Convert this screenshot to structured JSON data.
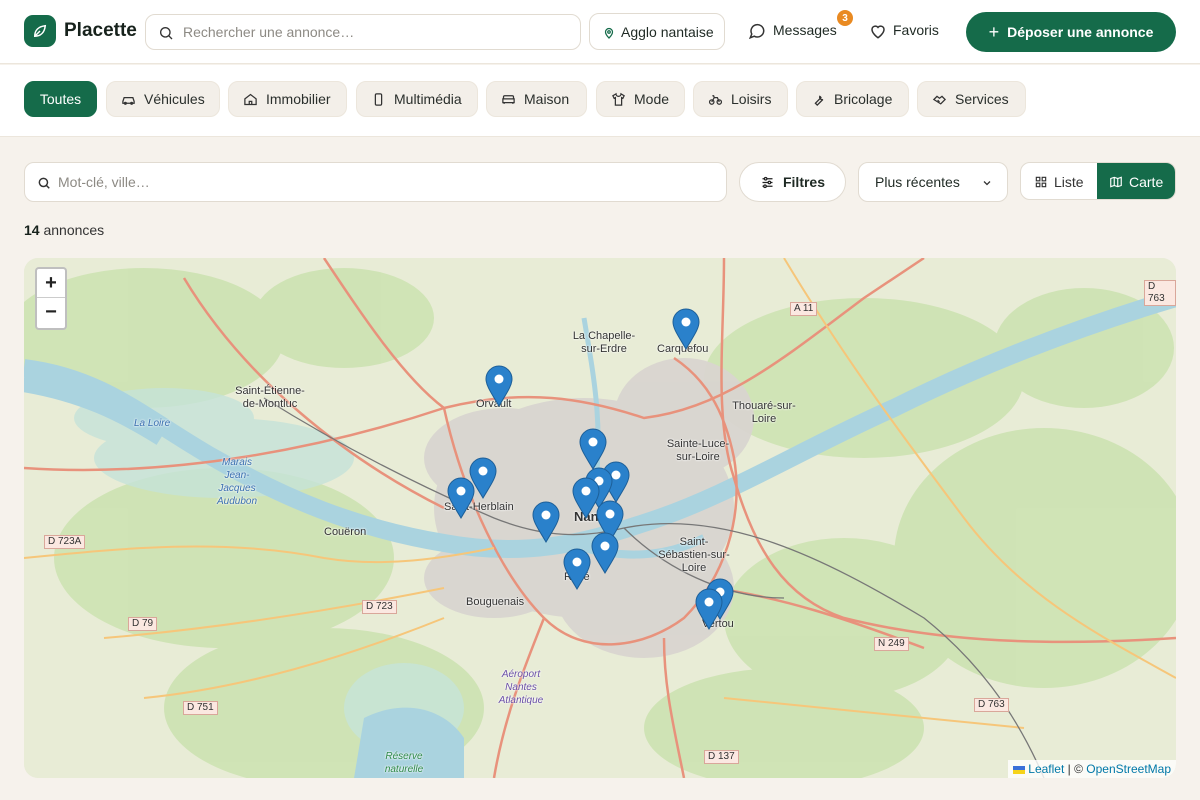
{
  "header": {
    "brand": "Placette",
    "search_placeholder": "Rechercher une annonce…",
    "location": "Agglo nantaise",
    "messages_label": "Messages",
    "messages_count": "3",
    "favorites_label": "Favoris",
    "post_label": "Déposer une annonce"
  },
  "categories": [
    {
      "label": "Toutes",
      "icon": "none",
      "active": true
    },
    {
      "label": "Véhicules",
      "icon": "car-icon"
    },
    {
      "label": "Immobilier",
      "icon": "home-icon"
    },
    {
      "label": "Multimédia",
      "icon": "phone-icon"
    },
    {
      "label": "Maison",
      "icon": "sofa-icon"
    },
    {
      "label": "Mode",
      "icon": "shirt-icon"
    },
    {
      "label": "Loisirs",
      "icon": "bike-icon"
    },
    {
      "label": "Bricolage",
      "icon": "wrench-icon"
    },
    {
      "label": "Services",
      "icon": "handshake-icon"
    }
  ],
  "toolbar": {
    "keyword_placeholder": "Mot-clé, ville…",
    "filters_label": "Filtres",
    "sort_value": "Plus récentes",
    "view_list": "Liste",
    "view_map": "Carte"
  },
  "results": {
    "count": "14",
    "label": "annonces"
  },
  "map": {
    "zoom_in": "+",
    "zoom_out": "−",
    "attribution_leaflet": "Leaflet",
    "attribution_sep": " | © ",
    "attribution_osm": "OpenStreetMap",
    "place_labels": [
      "Saint-Étienne-de-Montluc",
      "La Chapelle-sur-Erdre",
      "Carquefou",
      "Orvault",
      "Thouaré-sur-Loire",
      "Sainte-Luce-sur-Loire",
      "Saint-Herblain",
      "Couëron",
      "Nantes",
      "Saint-Sébastien-sur-Loire",
      "Rezé",
      "Bouguenais",
      "Vertou",
      "Aéroport Nantes Atlantique",
      "Marais Jean-Jacques Audubon",
      "La Loire",
      "Réserve naturelle"
    ],
    "road_labels": [
      "A 11",
      "D 763",
      "D 723A",
      "D 723",
      "D 79",
      "D 751",
      "D 137",
      "N 249"
    ],
    "marker_count": 14,
    "colors": {
      "brand": "#156b4a",
      "marker": "#2a81cb",
      "badge": "#e98a22"
    }
  }
}
